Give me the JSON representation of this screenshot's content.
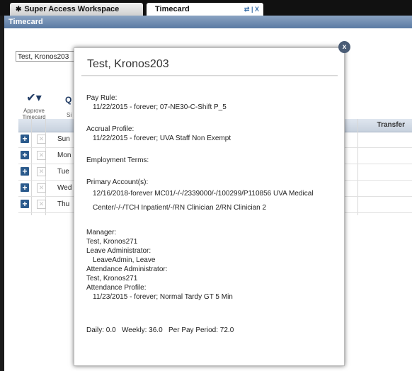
{
  "tabs": {
    "workspace": "Super Access Workspace",
    "timecard": "Timecard",
    "timecard_controls": "⇄ | X"
  },
  "window": {
    "title": "Timecard"
  },
  "employee_select": {
    "value": "Test, Kronos203"
  },
  "toolbar": {
    "approve_label_1": "Approve",
    "approve_label_2": "Timecard",
    "sign_icon_glyph": "Q",
    "sign_label": "Si"
  },
  "grid": {
    "transfer_header": "Transfer",
    "rows": [
      {
        "day": "Sun"
      },
      {
        "day": "Mon"
      },
      {
        "day": "Tue"
      },
      {
        "day": "Wed"
      },
      {
        "day": "Thu"
      }
    ]
  },
  "popup": {
    "close": "x",
    "name": "Test, Kronos203",
    "pay_rule_label": "Pay Rule:",
    "pay_rule_value": "11/22/2015 - forever; 07-NE30-C-Shift P_5",
    "accrual_label": "Accrual Profile:",
    "accrual_value": "11/22/2015 - forever; UVA Staff Non Exempt",
    "employment_terms_label": "Employment Terms:",
    "primary_account_label": "Primary Account(s):",
    "primary_account_line1": "12/16/2018-forever MC01/-/-/2339000/-/100299/P110856 UVA Medical",
    "primary_account_line2": "Center/-/-/TCH Inpatient/-/RN Clinician 2/RN Clinician 2",
    "manager_label": "Manager:",
    "manager_value": "Test, Kronos271",
    "leave_admin_label": "Leave Administrator:",
    "leave_admin_value": "LeaveAdmin, Leave",
    "attendance_admin_label": "Attendance Administrator:",
    "attendance_admin_value": "Test, Kronos271",
    "attendance_profile_label": "Attendance Profile:",
    "attendance_profile_value": "11/23/2015 - forever; Normal Tardy GT 5 Min",
    "summary": "Daily: 0.0   Weekly: 36.0   Per Pay Period: 72.0"
  }
}
